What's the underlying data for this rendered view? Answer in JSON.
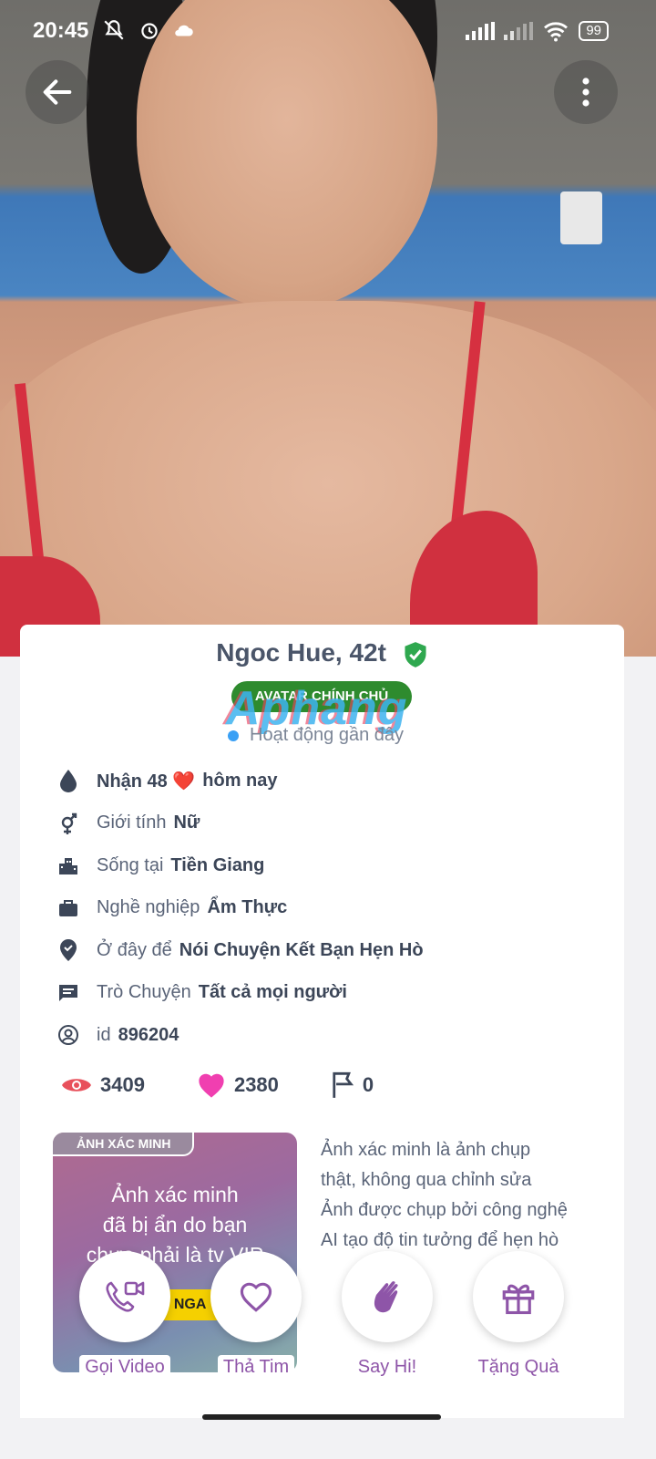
{
  "status_bar": {
    "time": "20:45",
    "battery": "99",
    "left_icons": [
      "mute-icon",
      "alarm-icon",
      "cloud-icon"
    ],
    "right_icons": [
      "signal-icon",
      "signal-icon",
      "wifi-icon",
      "battery-icon"
    ]
  },
  "profile": {
    "name": "Ngoc Hue, 42t",
    "verified_badge": "AVATAR CHÍNH CHỦ",
    "watermark": "Aphang",
    "activity": "Hoạt động gần đây"
  },
  "info": [
    {
      "icon": "drop-icon",
      "label": "Nhận 48 ❤️",
      "value": "hôm nay"
    },
    {
      "icon": "gender-icon",
      "label": "Giới tính",
      "value": "Nữ"
    },
    {
      "icon": "city-icon",
      "label": "Sống tại",
      "value": "Tiền Giang"
    },
    {
      "icon": "briefcase-icon",
      "label": "Nghề nghiệp",
      "value": "Ẩm Thực"
    },
    {
      "icon": "location-check-icon",
      "label": "Ở đây để",
      "value": "Nói Chuyện Kết Bạn Hẹn Hò"
    },
    {
      "icon": "chat-icon",
      "label": "Trò Chuyện",
      "value": "Tất cả mọi người"
    },
    {
      "icon": "user-circle-icon",
      "label": "id",
      "value": "896204"
    }
  ],
  "stats": {
    "views": "3409",
    "likes": "2380",
    "flags": "0"
  },
  "verify": {
    "tag": "ẢNH XÁC MINH",
    "line1": "Ảnh xác minh",
    "line2": "đã bị ẩn do bạn",
    "line3": "chưa phải là tv VIP",
    "vip_cta": "P NGA",
    "desc": [
      "Ảnh xác minh là ảnh chụp",
      "thật, không qua chỉnh sửa",
      "Ảnh được chụp bởi công nghệ",
      "AI tạo độ tin tưởng để hẹn hò"
    ]
  },
  "actions": [
    {
      "label": "Gọi Video",
      "icon": "video-call-icon"
    },
    {
      "label": "Thả Tim",
      "icon": "heart-outline-icon"
    },
    {
      "label": "Say Hi!",
      "icon": "wave-hand-icon"
    },
    {
      "label": "Tặng Quà",
      "icon": "gift-icon"
    }
  ],
  "colors": {
    "accent": "#8e55a8",
    "verified_green": "#2e8b2e",
    "like_pink": "#f03fb0",
    "view_red": "#e8505b"
  }
}
